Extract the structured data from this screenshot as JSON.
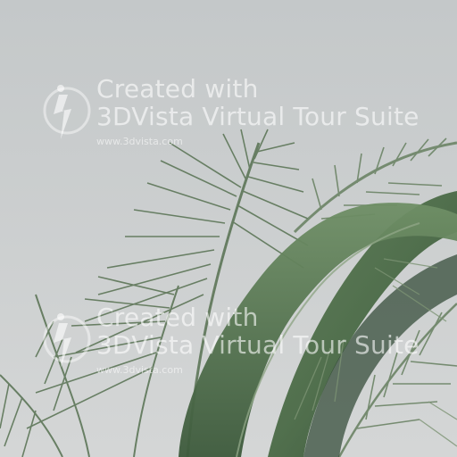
{
  "scene": {
    "description_icon": "palm-fronds-photo",
    "colors": {
      "sky": "#c9cccd",
      "frond_dark": "#3f5a3c",
      "frond_mid": "#5f7d57",
      "frond_light": "#9fb29a"
    }
  },
  "watermarks": [
    {
      "line1": "Created with",
      "line2": "3DVista Virtual Tour Suite",
      "url": "www.3dvista.com"
    },
    {
      "line1": "Created with",
      "line2": "3DVista Virtual Tour Suite",
      "url": "www.3dvista.com"
    }
  ]
}
